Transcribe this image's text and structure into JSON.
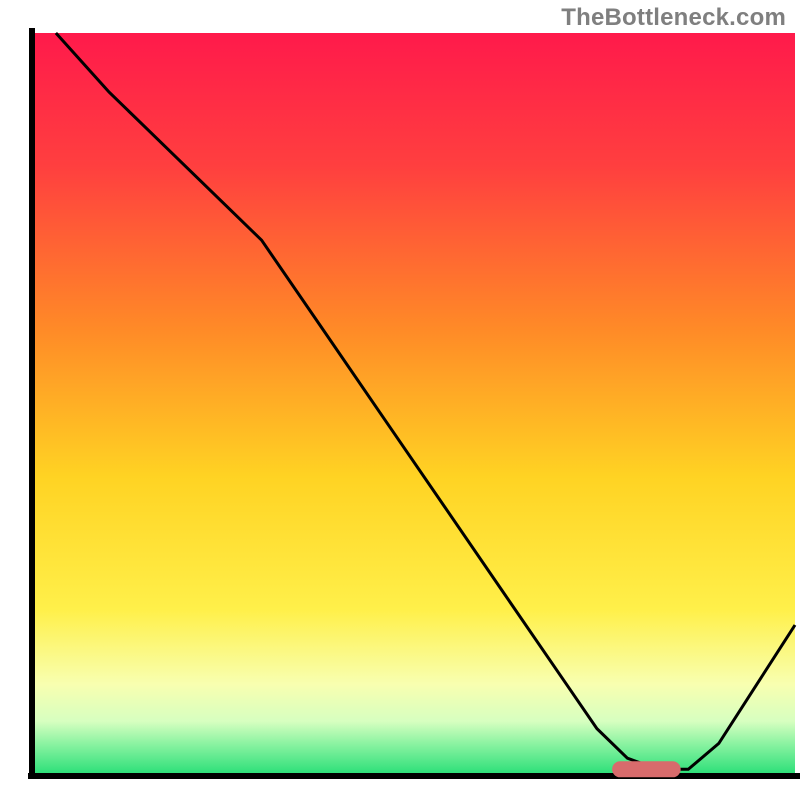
{
  "watermark": "TheBottleneck.com",
  "chart_data": {
    "type": "line",
    "title": "",
    "xlabel": "",
    "ylabel": "",
    "xlim": [
      0,
      100
    ],
    "ylim": [
      0,
      100
    ],
    "background_gradient": {
      "top": "#ff1a4b",
      "upper_mid": "#ff8a27",
      "mid": "#ffe324",
      "lower_mid": "#f9ff70",
      "bottom_band": "#2fe07a"
    },
    "series": [
      {
        "name": "bottleneck-curve",
        "x": [
          3,
          10,
          18,
          25,
          30,
          38,
          46,
          54,
          62,
          70,
          74,
          78,
          82,
          86,
          90,
          95,
          100
        ],
        "y": [
          100,
          92,
          84,
          77,
          72,
          60,
          48,
          36,
          24,
          12,
          6,
          2,
          0.5,
          0.5,
          4,
          12,
          20
        ]
      }
    ],
    "annotations": [
      {
        "name": "marker-bar",
        "x_start": 76,
        "x_end": 85,
        "y": 0.5,
        "color": "#d86b6c"
      }
    ],
    "axes": {
      "x_axis_visible": true,
      "y_axis_visible": true,
      "ticks_visible": false,
      "grid": false
    }
  }
}
